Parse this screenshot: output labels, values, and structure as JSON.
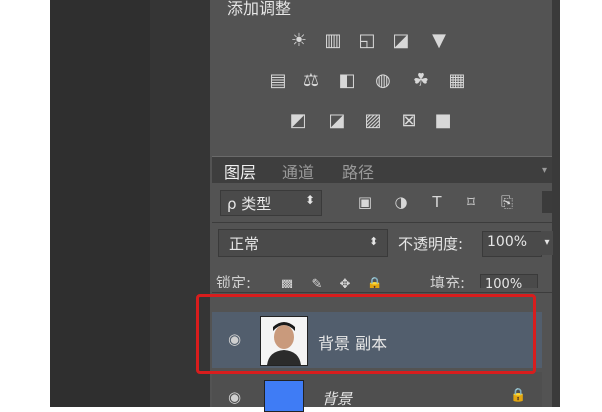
{
  "adjustments": {
    "title": "添加调整",
    "row1_icons": [
      "brightness-contrast-icon",
      "levels-icon",
      "curves-icon",
      "exposure-icon",
      "vibrance-icon"
    ],
    "row2_icons": [
      "hue-saturation-icon",
      "color-balance-icon",
      "black-white-icon",
      "photo-filter-icon",
      "channel-mixer-icon",
      "color-lookup-icon"
    ],
    "row3_icons": [
      "invert-icon",
      "posterize-icon",
      "threshold-icon",
      "gradient-map-icon",
      "selective-color-icon"
    ]
  },
  "tabs": [
    {
      "label": "图层",
      "active": true
    },
    {
      "label": "通道",
      "active": false
    },
    {
      "label": "路径",
      "active": false
    }
  ],
  "filter": {
    "value": "ρ 类型",
    "arrow": "⬍"
  },
  "blend": {
    "mode": "正常",
    "opacity_label": "不透明度:",
    "opacity_value": "100%"
  },
  "lock": {
    "label": "锁定:",
    "fill_label": "填充:",
    "fill_value": "100%"
  },
  "layers": [
    {
      "name": "背景 副本",
      "selected": true
    },
    {
      "name": "背景",
      "selected": false,
      "locked": true
    }
  ],
  "colors": {
    "panel": "#535353",
    "selected_layer": "#525e6d",
    "highlight": "#d81d1d",
    "swatch": "#3f7cf5"
  }
}
